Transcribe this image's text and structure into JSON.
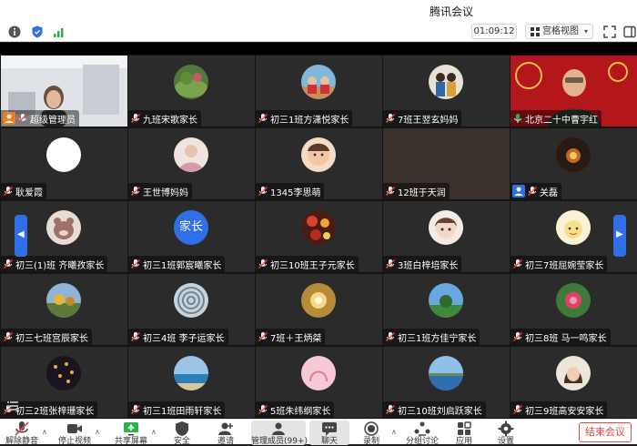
{
  "app": {
    "title": "腾讯会议"
  },
  "toolbar": {
    "timer": "01:09:12",
    "view_label": "宫格视图"
  },
  "participants": [
    {
      "name": "超级管理员",
      "badge": "host"
    },
    {
      "name": "九班宋歌家长"
    },
    {
      "name": "初三1班方潇悦家长"
    },
    {
      "name": "7班王翌玄妈妈"
    },
    {
      "name": "北京二十中曹宇红",
      "mic": "on"
    },
    {
      "name": "耿爱霞"
    },
    {
      "name": "王世博妈妈"
    },
    {
      "name": "1345李思萌"
    },
    {
      "name": "12班于天润"
    },
    {
      "name": "关磊",
      "badge": "user"
    },
    {
      "name": "初三(1)班 齐曦孜家长"
    },
    {
      "name": "初三1班郭宸曦家长"
    },
    {
      "name": "初三10班王子元家长"
    },
    {
      "name": "3班白梓培家长"
    },
    {
      "name": "初三7班屈婉莹家长"
    },
    {
      "name": "初三七班宫辰家长"
    },
    {
      "name": "初三4班 李子运家长"
    },
    {
      "name": "7班＋王炳桀"
    },
    {
      "name": "初三1班方佳宁家长"
    },
    {
      "name": "初三8班 马一鸣家长"
    },
    {
      "name": "初三2班张梓珊家长"
    },
    {
      "name": "初三1班田雨轩家长"
    },
    {
      "name": "5班朱纬纲家长"
    },
    {
      "name": "初三10班刘启跃家长"
    },
    {
      "name": "初三9班高安安家长"
    }
  ],
  "avatar_text": {
    "parent": "家长"
  },
  "bottom_bar": {
    "mute": "解除静音",
    "video": "停止视频",
    "share": "共享屏幕",
    "security": "安全",
    "invite": "邀请",
    "members": "管理成员(99+)",
    "chat": "聊天",
    "record": "录制",
    "breakout": "分组讨论",
    "apps": "应用",
    "settings": "设置",
    "end": "结束会议"
  },
  "colors": {
    "accent": "#2f6fe8",
    "end": "#e64545",
    "host_badge": "#f07c1b"
  }
}
